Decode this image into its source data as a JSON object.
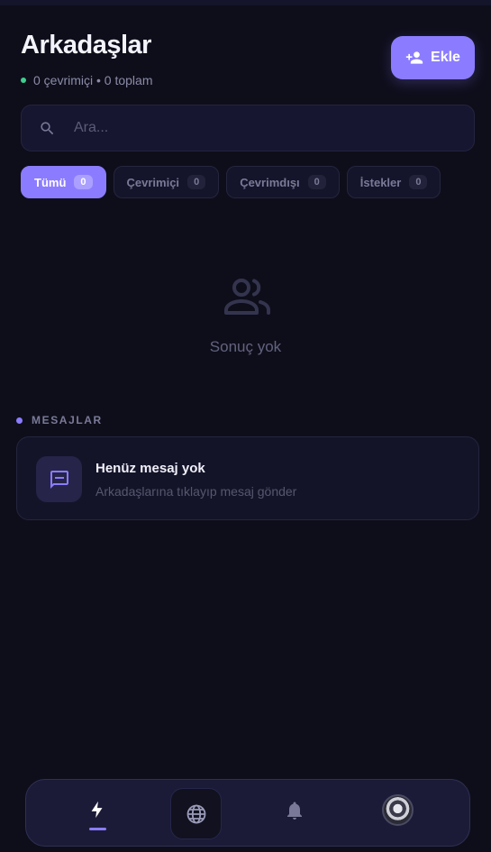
{
  "header": {
    "title": "Arkadaşlar",
    "status_text": "0 çevrimiçi • 0 toplam",
    "add_label": "Ekle"
  },
  "search": {
    "placeholder": "Ara..."
  },
  "tabs": [
    {
      "label": "Tümü",
      "count": "0",
      "active": true
    },
    {
      "label": "Çevrimiçi",
      "count": "0",
      "active": false
    },
    {
      "label": "Çevrimdışı",
      "count": "0",
      "active": false
    },
    {
      "label": "İstekler",
      "count": "0",
      "active": false
    }
  ],
  "empty_state": {
    "icon": "people-icon",
    "text": "Sonuç yok"
  },
  "messages": {
    "section_label": "MESAJLAR",
    "empty_title": "Henüz mesaj yok",
    "empty_subtitle": "Arkadaşlarına tıklayıp mesaj gönder"
  },
  "bottom_nav": {
    "items": [
      "lightning-icon",
      "globe-icon",
      "bell-icon",
      "avatar"
    ]
  },
  "colors": {
    "background": "#0e0e1b",
    "accent": "#8b7cff",
    "online": "#3ecf8e"
  }
}
